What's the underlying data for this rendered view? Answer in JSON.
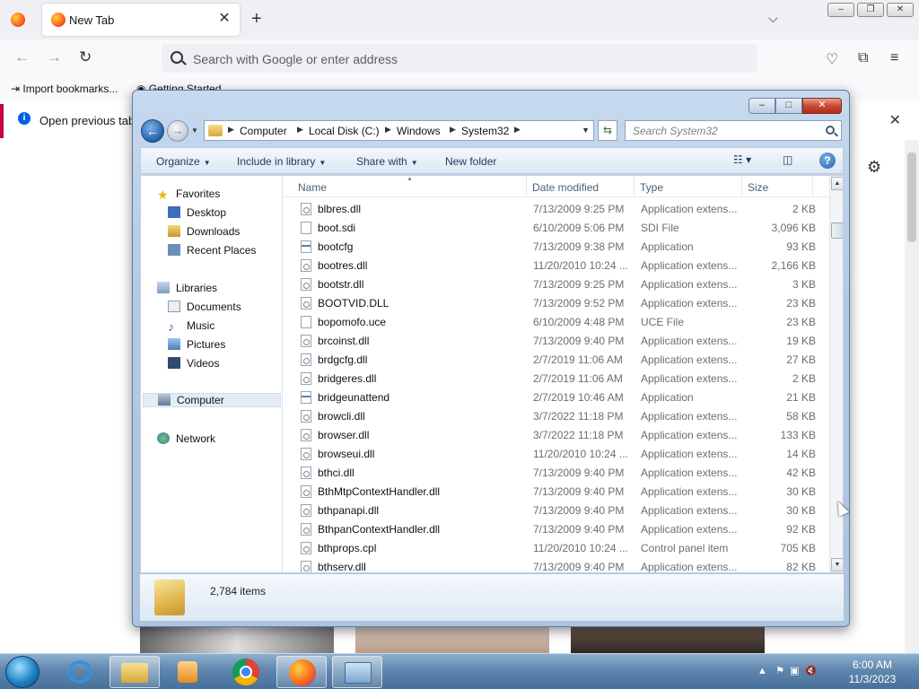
{
  "browser": {
    "tab_title": "New Tab",
    "tab_close": "✕",
    "new_tab": "+",
    "list_tabs": "⌵",
    "url_placeholder": "Search with Google or enter address",
    "bookmarks": [
      {
        "label": "Import bookmarks..."
      },
      {
        "label": "Getting Started"
      }
    ],
    "notification": "Open previous tabs",
    "window_buttons": [
      "–",
      "❐",
      "✕"
    ]
  },
  "explorer": {
    "window_buttons": [
      "–",
      "□",
      "✕"
    ],
    "breadcrumbs": [
      "Computer",
      "Local Disk (C:)",
      "Windows",
      "System32"
    ],
    "search_placeholder": "Search System32",
    "toolbar": {
      "organize": "Organize",
      "include_in_library": "Include in library",
      "share_with": "Share with",
      "new_folder": "New folder"
    },
    "nav": {
      "favorites": "Favorites",
      "desktop": "Desktop",
      "downloads": "Downloads",
      "recent_places": "Recent Places",
      "libraries": "Libraries",
      "documents": "Documents",
      "music": "Music",
      "pictures": "Pictures",
      "videos": "Videos",
      "computer": "Computer",
      "network": "Network"
    },
    "columns": {
      "name": "Name",
      "date": "Date modified",
      "type": "Type",
      "size": "Size"
    },
    "files": [
      {
        "name": "blbres.dll",
        "date": "7/13/2009 9:25 PM",
        "type": "Application extens...",
        "size": "2 KB",
        "icon": "dll"
      },
      {
        "name": "boot.sdi",
        "date": "6/10/2009 5:06 PM",
        "type": "SDI File",
        "size": "3,096 KB",
        "icon": "file"
      },
      {
        "name": "bootcfg",
        "date": "7/13/2009 9:38 PM",
        "type": "Application",
        "size": "93 KB",
        "icon": "app"
      },
      {
        "name": "bootres.dll",
        "date": "11/20/2010 10:24 ...",
        "type": "Application extens...",
        "size": "2,166 KB",
        "icon": "dll"
      },
      {
        "name": "bootstr.dll",
        "date": "7/13/2009 9:25 PM",
        "type": "Application extens...",
        "size": "3 KB",
        "icon": "dll"
      },
      {
        "name": "BOOTVID.DLL",
        "date": "7/13/2009 9:52 PM",
        "type": "Application extens...",
        "size": "23 KB",
        "icon": "dll"
      },
      {
        "name": "bopomofo.uce",
        "date": "6/10/2009 4:48 PM",
        "type": "UCE File",
        "size": "23 KB",
        "icon": "file"
      },
      {
        "name": "brcoinst.dll",
        "date": "7/13/2009 9:40 PM",
        "type": "Application extens...",
        "size": "19 KB",
        "icon": "dll"
      },
      {
        "name": "brdgcfg.dll",
        "date": "2/7/2019 11:06 AM",
        "type": "Application extens...",
        "size": "27 KB",
        "icon": "dll"
      },
      {
        "name": "bridgeres.dll",
        "date": "2/7/2019 11:06 AM",
        "type": "Application extens...",
        "size": "2 KB",
        "icon": "dll"
      },
      {
        "name": "bridgeunattend",
        "date": "2/7/2019 10:46 AM",
        "type": "Application",
        "size": "21 KB",
        "icon": "app"
      },
      {
        "name": "browcli.dll",
        "date": "3/7/2022 11:18 PM",
        "type": "Application extens...",
        "size": "58 KB",
        "icon": "dll"
      },
      {
        "name": "browser.dll",
        "date": "3/7/2022 11:18 PM",
        "type": "Application extens...",
        "size": "133 KB",
        "icon": "dll"
      },
      {
        "name": "browseui.dll",
        "date": "11/20/2010 10:24 ...",
        "type": "Application extens...",
        "size": "14 KB",
        "icon": "dll"
      },
      {
        "name": "bthci.dll",
        "date": "7/13/2009 9:40 PM",
        "type": "Application extens...",
        "size": "42 KB",
        "icon": "dll"
      },
      {
        "name": "BthMtpContextHandler.dll",
        "date": "7/13/2009 9:40 PM",
        "type": "Application extens...",
        "size": "30 KB",
        "icon": "dll"
      },
      {
        "name": "bthpanapi.dll",
        "date": "7/13/2009 9:40 PM",
        "type": "Application extens...",
        "size": "30 KB",
        "icon": "dll"
      },
      {
        "name": "BthpanContextHandler.dll",
        "date": "7/13/2009 9:40 PM",
        "type": "Application extens...",
        "size": "92 KB",
        "icon": "dll"
      },
      {
        "name": "bthprops.cpl",
        "date": "11/20/2010 10:24 ...",
        "type": "Control panel item",
        "size": "705 KB",
        "icon": "dll"
      },
      {
        "name": "bthserv.dll",
        "date": "7/13/2009 9:40 PM",
        "type": "Application extens...",
        "size": "82 KB",
        "icon": "dll"
      }
    ],
    "item_count": "2,784 items"
  },
  "taskbar": {
    "clock_time": "6:00 AM",
    "clock_date": "11/3/2023"
  }
}
